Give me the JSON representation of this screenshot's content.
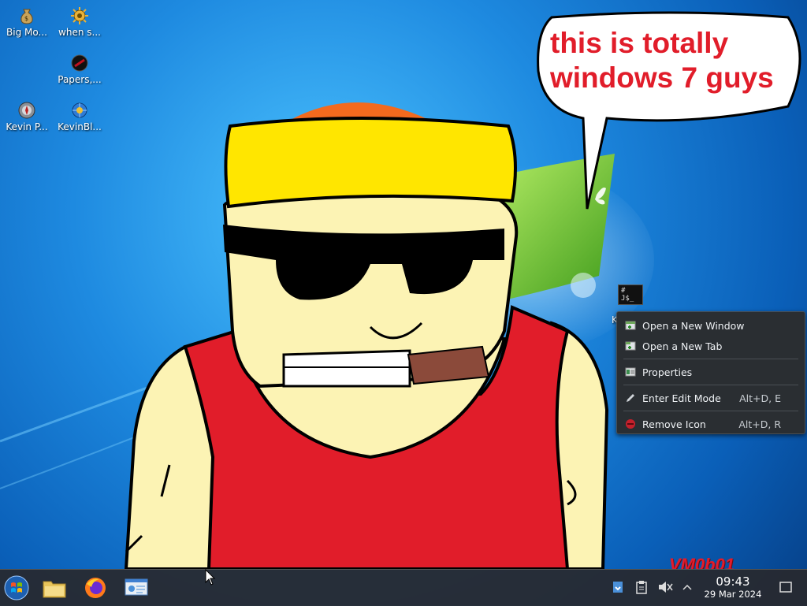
{
  "desktop_icons": [
    {
      "label": "Big Mo...",
      "icon": "money-bag-icon"
    },
    {
      "label": "when s...",
      "icon": "gear-sun-icon"
    },
    {
      "label": "Papers,...",
      "icon": "papers-please-icon"
    },
    {
      "label": "Kevin P...",
      "icon": "compass-icon"
    },
    {
      "label": "KevinBl...",
      "icon": "globe-gear-icon"
    }
  ],
  "wallpaper": {
    "speech_line1": "this is totally",
    "speech_line2": "windows 7 guys",
    "watermark": "VM0b01"
  },
  "selected_icon": {
    "thumb_text": "# J$_",
    "label": "K"
  },
  "context_menu": {
    "items": [
      {
        "label": "Open a New Window",
        "shortcut": "",
        "icon": "new-window-icon"
      },
      {
        "label": "Open a New Tab",
        "shortcut": "",
        "icon": "new-tab-icon"
      },
      {
        "label": "Properties",
        "shortcut": "",
        "icon": "properties-icon"
      },
      {
        "label": "Enter Edit Mode",
        "shortcut": "Alt+D, E",
        "icon": "edit-pencil-icon"
      },
      {
        "label": "Remove Icon",
        "shortcut": "Alt+D, R",
        "icon": "remove-icon"
      }
    ]
  },
  "taskbar": {
    "launchers": [
      "start-orb-icon",
      "file-manager-icon",
      "firefox-icon",
      "system-settings-icon"
    ],
    "tray": [
      "updates-icon",
      "clipboard-icon",
      "volume-muted-icon",
      "tray-expand-icon",
      "show-desktop-icon"
    ],
    "clock": {
      "time": "09:43",
      "date": "29 Mar 2024"
    }
  },
  "colors": {
    "speech_text": "#e11d2a",
    "menu_bg": "#2a2e32",
    "taskbar_bg": "#28282c"
  }
}
